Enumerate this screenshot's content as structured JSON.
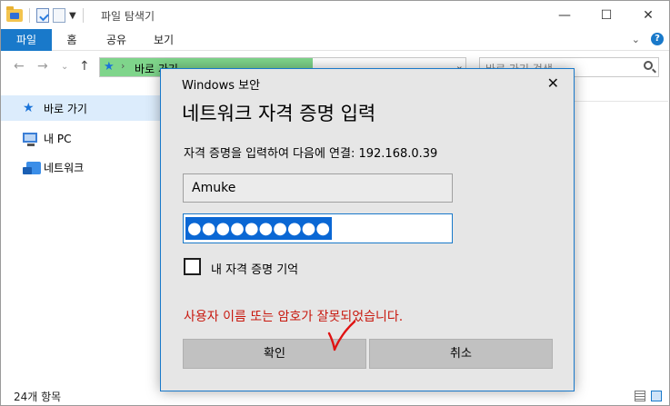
{
  "explorer": {
    "title": "파일 탐색기",
    "ribbon_tabs": [
      "파일",
      "홈",
      "공유",
      "보기"
    ],
    "address": {
      "location": "바로 가기",
      "search_placeholder": "바로 가기 검색"
    },
    "nav": {
      "items": [
        {
          "label": "바로 가기",
          "icon": "star-icon",
          "selected": true
        },
        {
          "label": "내 PC",
          "icon": "computer-icon",
          "selected": false
        },
        {
          "label": "네트워크",
          "icon": "network-icon",
          "selected": false
        }
      ]
    },
    "status": {
      "item_count": "24개 항목"
    }
  },
  "dialog": {
    "caption": "Windows 보안",
    "heading": "네트워크 자격 증명 입력",
    "description": "자격 증명을 입력하여 다음에 연결: 192.168.0.39",
    "username": "Amuke",
    "password_mask": "●●●●●●●●●●",
    "remember_label": "내 자격 증명 기억",
    "remember_checked": false,
    "error_message": "사용자 이름 또는 암호가 잘못되었습니다.",
    "ok_label": "확인",
    "cancel_label": "취소"
  },
  "colors": {
    "accent": "#1979ca",
    "error": "#c8190f",
    "address_highlight": "#7fd58b",
    "annotation": "#e01212"
  }
}
